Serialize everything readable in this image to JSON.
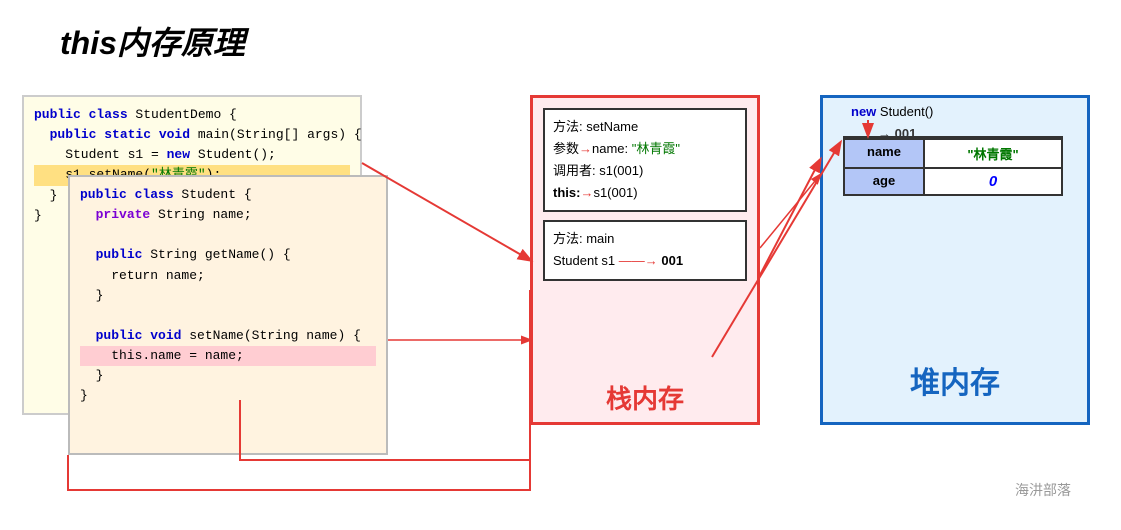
{
  "title": {
    "prefix": "this",
    "suffix": "内存原理"
  },
  "code_outer": {
    "lines": [
      {
        "type": "kw+text",
        "kw": "public class",
        "rest": " StudentDemo {"
      },
      {
        "type": "indent1+kw+text",
        "kw": "public static void",
        "rest": " main(String[] args) {"
      },
      {
        "type": "indent2",
        "text": "Student s1 = ",
        "kw": "new",
        "rest": " Student();"
      },
      {
        "type": "highlight",
        "text": "    s1.setName(\"林青霞\");"
      },
      {
        "type": "indent0",
        "text": "}"
      }
    ]
  },
  "code_inner": {
    "lines": [
      {
        "kw": "public class",
        "rest": " Student {"
      },
      {
        "indent": 1,
        "kw": "private",
        "rest": " String name;"
      },
      {
        "indent": 0,
        "text": ""
      },
      {
        "indent": 1,
        "kw": "public",
        "rest": " String getName() {"
      },
      {
        "indent": 2,
        "text": "return name;"
      },
      {
        "indent": 1,
        "text": "}"
      },
      {
        "indent": 0,
        "text": ""
      },
      {
        "indent": 1,
        "kw": "public void",
        "rest": " setName(String name) {"
      },
      {
        "highlight": true,
        "text": "        this.name = name;"
      },
      {
        "indent": 1,
        "text": "}"
      },
      {
        "indent": 0,
        "text": "}"
      }
    ]
  },
  "stack": {
    "label": "栈内存",
    "method1": {
      "title": "方法: setName",
      "param": "参数: name: \"林青霞\"",
      "caller": "调用者: s1(001)",
      "this": "this: →s1(001)"
    },
    "method2": {
      "title": "方法: main",
      "s1": "Student s1  →  001"
    }
  },
  "heap": {
    "label": "堆内存",
    "new_label": "new Student()",
    "addr": "001",
    "fields": [
      {
        "name": "name",
        "value": "\"林青霞\"",
        "type": "string"
      },
      {
        "name": "age",
        "value": "0",
        "type": "number"
      }
    ]
  },
  "watermark": "海汫部落"
}
